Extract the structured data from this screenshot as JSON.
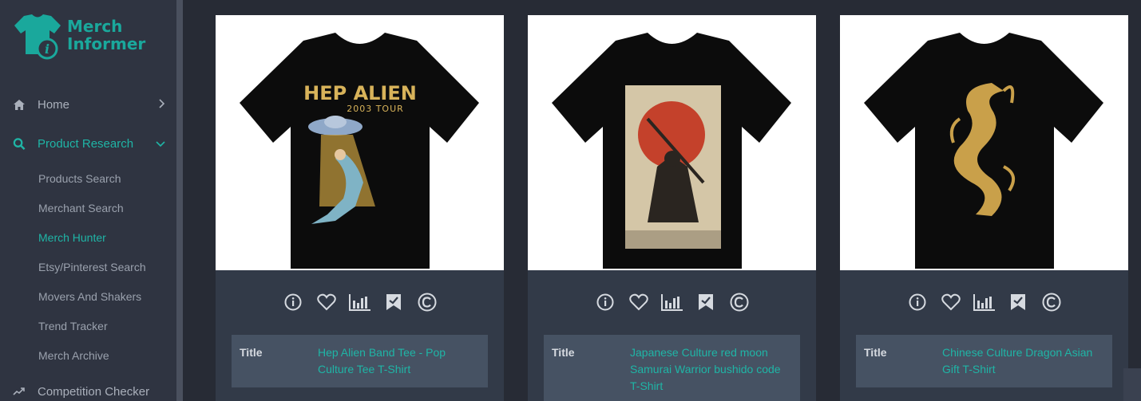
{
  "brand": {
    "name_line1": "Merch",
    "name_line2": "Informer",
    "color": "#1aa89c"
  },
  "sidebar": {
    "items": [
      {
        "label": "Home",
        "icon": "home-icon"
      },
      {
        "label": "Product Research",
        "icon": "search-icon"
      }
    ],
    "subitems": [
      {
        "label": "Products Search"
      },
      {
        "label": "Merchant Search"
      },
      {
        "label": "Merch Hunter"
      },
      {
        "label": "Etsy/Pinterest Search"
      },
      {
        "label": "Movers And Shakers"
      },
      {
        "label": "Trend Tracker"
      },
      {
        "label": "Merch Archive"
      }
    ],
    "bottom_item": {
      "label": "Competition Checker",
      "icon": "trend-icon"
    }
  },
  "products": [
    {
      "title_label": "Title",
      "title": "Hep Alien Band Tee - Pop Culture Tee T-Shirt",
      "design_text_1": "HEP ALIEN",
      "design_text_2": "2003 TOUR"
    },
    {
      "title_label": "Title",
      "title": "Japanese Culture red moon Samurai Warrior bushido code T-Shirt"
    },
    {
      "title_label": "Title",
      "title": "Chinese Culture Dragon Asian Gift T-Shirt"
    }
  ],
  "colors": {
    "accent": "#1fb5a6",
    "card_bg": "#323a48",
    "info_bg": "#465263"
  }
}
